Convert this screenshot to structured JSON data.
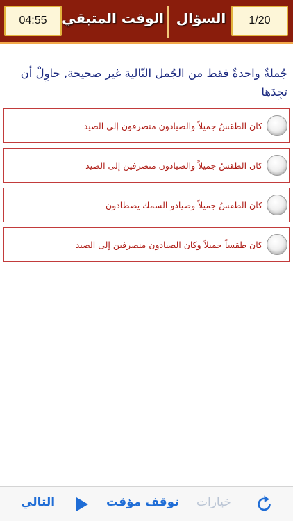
{
  "header": {
    "timer": "04:55",
    "remaining_label": "الوقت المتبقي",
    "question_label": "السؤال",
    "counter": "1/20"
  },
  "question": {
    "text": "جُملةٌ واحدةٌ فقط من الجُمل التّالية غير صحيحة, حاوِلْ أن تجِدَها"
  },
  "options": [
    {
      "text": "كان الطقسُ جميلاً والصيادون منصرفون إلى الصيد",
      "selected": false
    },
    {
      "text": "كان الطقسُ جميلاً والصيادون منصرفين إلى الصيد",
      "selected": false
    },
    {
      "text": "كان الطقسُ جميلاً وصيادو السمك يصطادون",
      "selected": false
    },
    {
      "text": "كان طقساً جميلاً وكان الصيادون منصرفين إلى الصيد",
      "selected": false
    }
  ],
  "toolbar": {
    "refresh_icon": "refresh-icon",
    "options_label": "خيارات",
    "pause_label": "توقف مؤقت",
    "play_icon": "play-icon",
    "next_label": "التالي"
  },
  "colors": {
    "header_bg": "#8a1d0c",
    "header_border": "#f2a94a",
    "question_text": "#1c2a80",
    "option_text": "#b0201a",
    "option_border": "#c23b3b",
    "accent_blue": "#1f6dd6",
    "disabled": "#b9c4d4"
  }
}
